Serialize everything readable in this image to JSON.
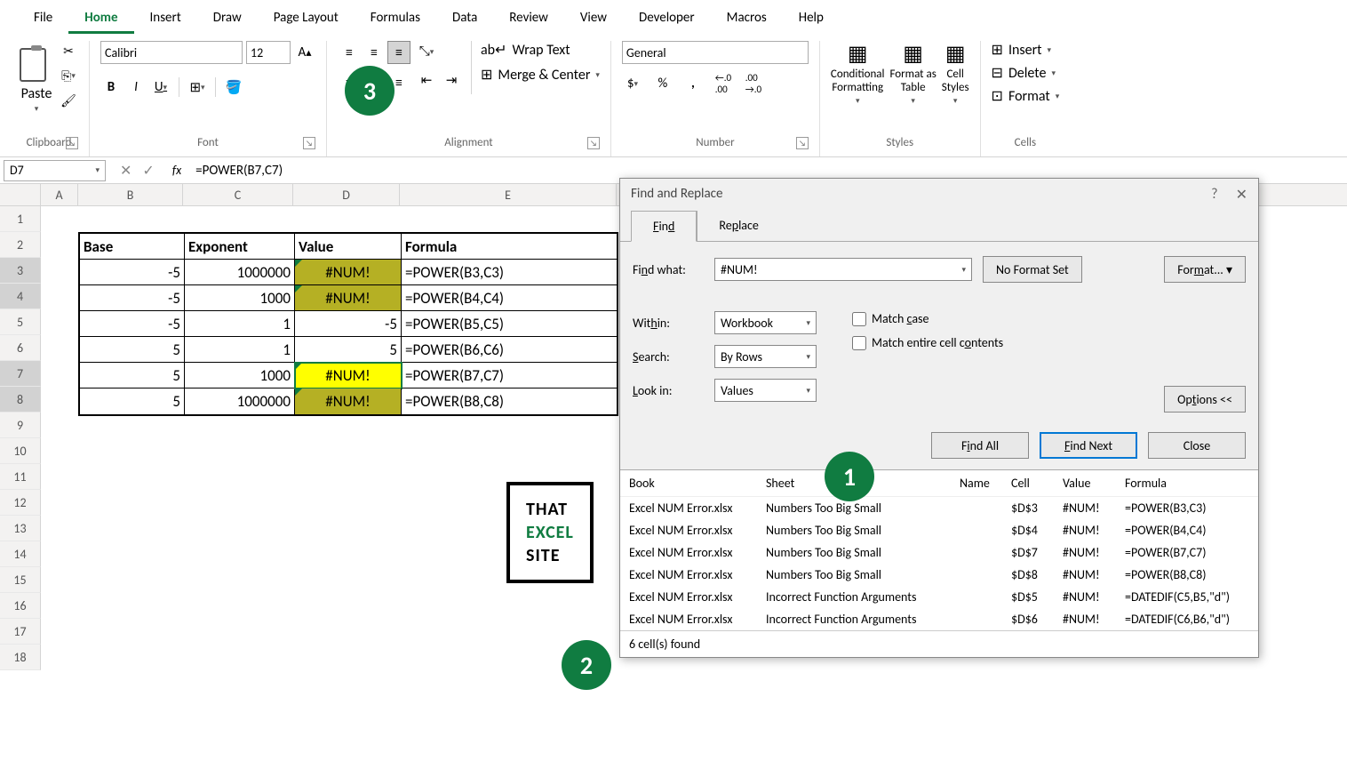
{
  "menus": [
    "File",
    "Home",
    "Insert",
    "Draw",
    "Page Layout",
    "Formulas",
    "Data",
    "Review",
    "View",
    "Developer",
    "Macros",
    "Help"
  ],
  "active_menu": "Home",
  "ribbon": {
    "clipboard": {
      "label": "Clipboard",
      "paste": "Paste"
    },
    "font": {
      "label": "Font",
      "name": "Calibri",
      "size": "12",
      "bold": "B",
      "italic": "I",
      "underline": "U"
    },
    "alignment": {
      "label": "Alignment",
      "wrap": "Wrap Text",
      "merge": "Merge & Center"
    },
    "number": {
      "label": "Number",
      "format": "General"
    },
    "styles": {
      "label": "Styles",
      "cond": "Conditional\nFormatting",
      "table": "Format as\nTable",
      "cell": "Cell\nStyles"
    },
    "cells": {
      "label": "Cells",
      "insert": "Insert",
      "delete": "Delete",
      "format": "Format"
    }
  },
  "name_box": "D7",
  "formula": "=POWER(B7,C7)",
  "columns": [
    "A",
    "B",
    "C",
    "D",
    "E"
  ],
  "rows": [
    1,
    2,
    3,
    4,
    5,
    6,
    7,
    8,
    9,
    10,
    11,
    12,
    13,
    14,
    15,
    16,
    17,
    18
  ],
  "table": {
    "headers": [
      "Base",
      "Exponent",
      "Value",
      "Formula"
    ],
    "data": [
      {
        "b": "-5",
        "c": "1000000",
        "d": "#NUM!",
        "e": "=POWER(B3,C3)",
        "err": true,
        "bright": false
      },
      {
        "b": "-5",
        "c": "1000",
        "d": "#NUM!",
        "e": "=POWER(B4,C4)",
        "err": true,
        "bright": false
      },
      {
        "b": "-5",
        "c": "1",
        "d": "-5",
        "e": "=POWER(B5,C5)",
        "err": false
      },
      {
        "b": "5",
        "c": "1",
        "d": "5",
        "e": "=POWER(B6,C6)",
        "err": false
      },
      {
        "b": "5",
        "c": "1000",
        "d": "#NUM!",
        "e": "=POWER(B7,C7)",
        "err": true,
        "bright": true,
        "selected": true
      },
      {
        "b": "5",
        "c": "1000000",
        "d": "#NUM!",
        "e": "=POWER(B8,C8)",
        "err": true,
        "bright": false
      }
    ]
  },
  "logo": {
    "l1": "THAT",
    "l2": "EXCEL",
    "l3": "SITE"
  },
  "dialog": {
    "title": "Find and Replace",
    "tabs": [
      "Find",
      "Replace"
    ],
    "find_label": "Find what:",
    "find_value": "#NUM!",
    "no_format": "No Format Set",
    "format_btn": "Format...",
    "within_label": "Within:",
    "within_value": "Workbook",
    "search_label": "Search:",
    "search_value": "By Rows",
    "lookin_label": "Look in:",
    "lookin_value": "Values",
    "match_case": "Match case",
    "match_entire": "Match entire cell contents",
    "options": "Options <<",
    "find_all": "Find All",
    "find_next": "Find Next",
    "close": "Close",
    "results_headers": [
      "Book",
      "Sheet",
      "Name",
      "Cell",
      "Value",
      "Formula"
    ],
    "results": [
      {
        "book": "Excel NUM Error.xlsx",
        "sheet": "Numbers Too Big Small",
        "name": "",
        "cell": "$D$3",
        "value": "#NUM!",
        "formula": "=POWER(B3,C3)"
      },
      {
        "book": "Excel NUM Error.xlsx",
        "sheet": "Numbers Too Big Small",
        "name": "",
        "cell": "$D$4",
        "value": "#NUM!",
        "formula": "=POWER(B4,C4)"
      },
      {
        "book": "Excel NUM Error.xlsx",
        "sheet": "Numbers Too Big Small",
        "name": "",
        "cell": "$D$7",
        "value": "#NUM!",
        "formula": "=POWER(B7,C7)"
      },
      {
        "book": "Excel NUM Error.xlsx",
        "sheet": "Numbers Too Big Small",
        "name": "",
        "cell": "$D$8",
        "value": "#NUM!",
        "formula": "=POWER(B8,C8)"
      },
      {
        "book": "Excel NUM Error.xlsx",
        "sheet": "Incorrect Function Arguments",
        "name": "",
        "cell": "$D$5",
        "value": "#NUM!",
        "formula": "=DATEDIF(C5,B5,\"d\")"
      },
      {
        "book": "Excel NUM Error.xlsx",
        "sheet": "Incorrect Function Arguments",
        "name": "",
        "cell": "$D$6",
        "value": "#NUM!",
        "formula": "=DATEDIF(C6,B6,\"d\")"
      }
    ],
    "status": "6 cell(s) found"
  },
  "badges": {
    "b1": "1",
    "b2": "2",
    "b3": "3"
  }
}
